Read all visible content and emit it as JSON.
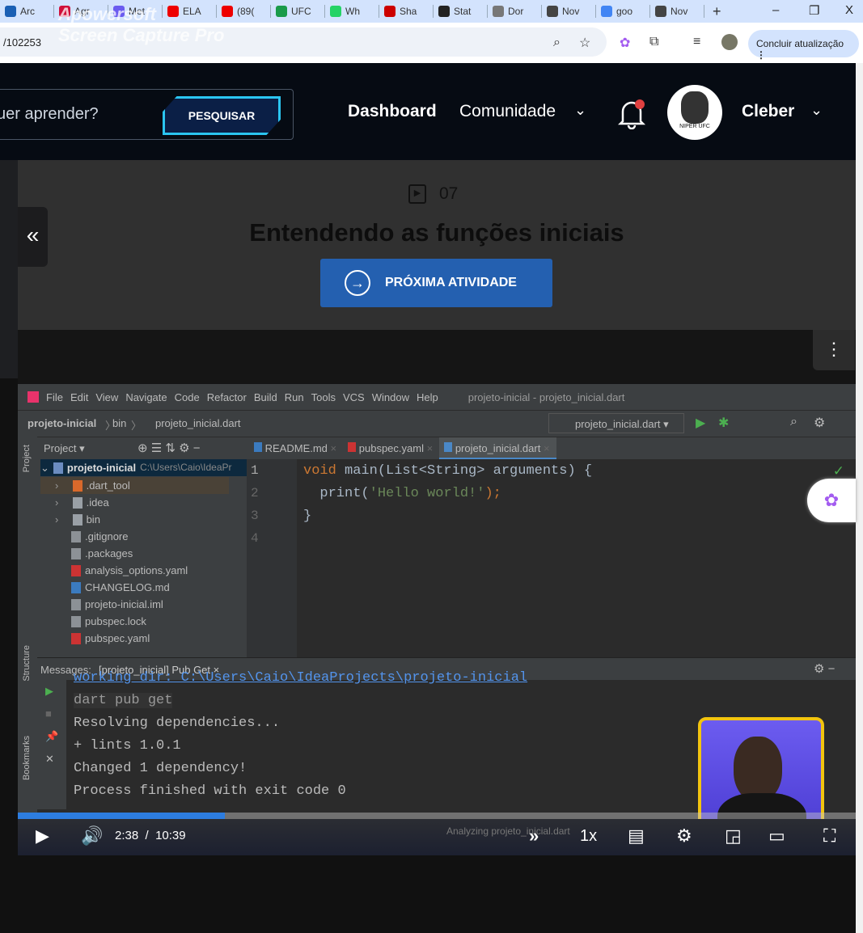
{
  "browser": {
    "tabs": [
      {
        "label": "Arc",
        "color": "#1a5fb4"
      },
      {
        "label": "Agr",
        "color": "#d0103a"
      },
      {
        "label": "Met",
        "color": "#6b5cf0"
      },
      {
        "label": "ELA",
        "color": "#e00"
      },
      {
        "label": "(89(",
        "color": "#e00"
      },
      {
        "label": "UFC",
        "color": "#1a9b4a"
      },
      {
        "label": "Wh",
        "color": "#25d366"
      },
      {
        "label": "Sha",
        "color": "#c00"
      },
      {
        "label": "Stat",
        "color": "#222"
      },
      {
        "label": "Dor",
        "color": "#777"
      },
      {
        "label": "Nov",
        "color": "#444"
      },
      {
        "label": "goo",
        "color": "#4285f4"
      },
      {
        "label": "Nov",
        "color": "#444"
      }
    ],
    "new_tab": "+",
    "minimize": "–",
    "restore": "❐",
    "close": "X",
    "url": "/102253",
    "update_label": "Concluir atualização",
    "watermark_line1": "Apowersoft",
    "watermark_line2": "Screen Capture Pro"
  },
  "header": {
    "search_placeholder": "uer aprender?",
    "search_button": "PESQUISAR",
    "nav_dashboard": "Dashboard",
    "nav_comunidade": "Comunidade",
    "user_name": "Cleber",
    "avatar_text": "NIPER UFC",
    "notification_color": "#e04040"
  },
  "lesson": {
    "number": "07",
    "title": "Entendendo as funções iniciais",
    "next_label": "PRÓXIMA ATIVIDADE",
    "accent": "#2460b0"
  },
  "ide": {
    "menu": [
      "File",
      "Edit",
      "View",
      "Navigate",
      "Code",
      "Refactor",
      "Build",
      "Run",
      "Tools",
      "VCS",
      "Window",
      "Help"
    ],
    "window_title": "projeto-inicial - projeto_inicial.dart",
    "breadcrumb": [
      "projeto-inicial",
      "bin",
      "projeto_inicial.dart"
    ],
    "run_config": "projeto_inicial.dart",
    "project_label": "Project",
    "side_project": "Project",
    "side_structure": "Structure",
    "side_bookmarks": "Bookmarks",
    "editor_tabs": [
      "README.md",
      "pubspec.yaml",
      "projeto_inicial.dart"
    ],
    "tree_root": "projeto-inicial",
    "tree_root_path": "C:\\Users\\Caio\\IdeaPr",
    "tree": [
      {
        "name": ".dart_tool",
        "type": "folder-orange"
      },
      {
        "name": ".idea",
        "type": "folder"
      },
      {
        "name": "bin",
        "type": "folder"
      },
      {
        "name": ".gitignore",
        "type": "file"
      },
      {
        "name": ".packages",
        "type": "file"
      },
      {
        "name": "analysis_options.yaml",
        "type": "yaml"
      },
      {
        "name": "CHANGELOG.md",
        "type": "md"
      },
      {
        "name": "projeto-inicial.iml",
        "type": "file"
      },
      {
        "name": "pubspec.lock",
        "type": "file"
      },
      {
        "name": "pubspec.yaml",
        "type": "yaml"
      }
    ],
    "line_numbers": [
      "1",
      "2",
      "3",
      "4"
    ],
    "code": {
      "l1_kw": "void",
      "l1_rest": " main(List<String> arguments) {",
      "l2_a": "  print(",
      "l2_str": "'Hello world!'",
      "l2_b": ");",
      "l3": "}"
    },
    "messages_label": "Messages:",
    "messages_tab": "[projeto_inicial] Pub Get",
    "console": [
      "working dir: C:\\Users\\Caio\\IdeaProjects\\projeto-inicial",
      "dart pub get",
      "Resolving dependencies...",
      "+ lints 1.0.1",
      "Changed 1 dependency!",
      "Process finished with exit code 0"
    ],
    "status_messages": "Messages",
    "status_analyzing": "Analyzing projeto_inicial.dart"
  },
  "player": {
    "current": "2:38",
    "separator": "/",
    "duration": "10:39",
    "progress_percent": 24.7,
    "speed": "1x"
  }
}
